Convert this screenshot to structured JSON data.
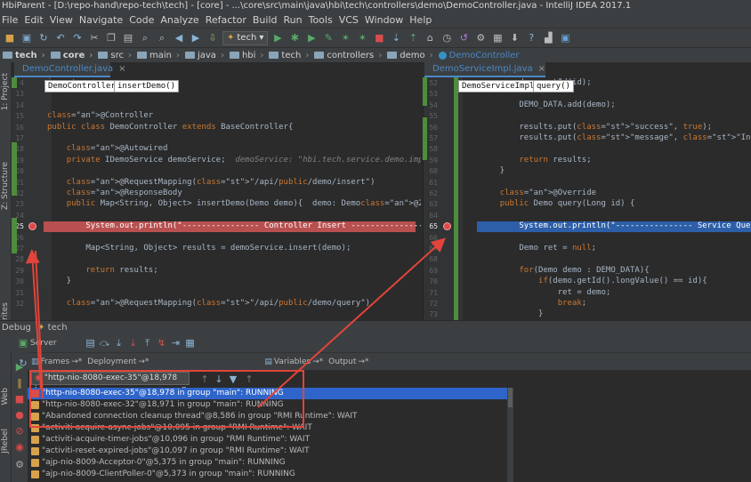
{
  "window": {
    "title": "HbiParent - [D:\\repo-hand\\repo-tech\\tech] - [core] - ...\\core\\src\\main\\java\\hbi\\tech\\controllers\\demo\\DemoController.java - IntelliJ IDEA 2017.1"
  },
  "menu": [
    "File",
    "Edit",
    "View",
    "Navigate",
    "Code",
    "Analyze",
    "Refactor",
    "Build",
    "Run",
    "Tools",
    "VCS",
    "Window",
    "Help"
  ],
  "toolbar": {
    "run_config": "tech"
  },
  "breadcrumbs": [
    "tech",
    "core",
    "src",
    "main",
    "java",
    "hbi",
    "tech",
    "controllers",
    "demo",
    "DemoController"
  ],
  "left_tabs": [
    "1: Project",
    "Z: Structure",
    "2: Favorites",
    "Web",
    "JRebel"
  ],
  "left_editor": {
    "tab": "DemoController.java",
    "crumbs": [
      "DemoController",
      "insertDemo()"
    ],
    "lines": [
      {
        "n": "4",
        "t": "import ..."
      },
      {
        "n": "13",
        "t": ""
      },
      {
        "n": "14",
        "t": ""
      },
      {
        "n": "15",
        "t": "@Controller"
      },
      {
        "n": "16",
        "t": "public class DemoController extends BaseController{"
      },
      {
        "n": "17",
        "t": ""
      },
      {
        "n": "18",
        "t": "    @Autowired"
      },
      {
        "n": "19",
        "t": "    private IDemoService demoService;  demoService: \"hbi.tech.service.demo.impl.Dem"
      },
      {
        "n": "20",
        "t": ""
      },
      {
        "n": "21",
        "t": "    @RequestMapping(\"/api/public/demo/insert\")"
      },
      {
        "n": "22",
        "t": "    @ResponseBody"
      },
      {
        "n": "23",
        "t": "    public Map<String, Object> insertDemo(Demo demo){  demo: Demo@20970"
      },
      {
        "n": "24",
        "t": ""
      },
      {
        "n": "25",
        "t": "        System.out.println(\"---------------- Controller Insert ----------------\");"
      },
      {
        "n": "26",
        "t": ""
      },
      {
        "n": "27",
        "t": "        Map<String, Object> results = demoService.insert(demo);"
      },
      {
        "n": "28",
        "t": ""
      },
      {
        "n": "29",
        "t": "        return results;"
      },
      {
        "n": "30",
        "t": "    }"
      },
      {
        "n": "31",
        "t": ""
      },
      {
        "n": "32",
        "t": "    @RequestMapping(\"/api/public/demo/query\")"
      }
    ]
  },
  "right_editor": {
    "tab": "DemoServiceImpl.java",
    "crumbs": [
      "DemoServiceImpl",
      "query()"
    ],
    "lines": [
      {
        "n": "52",
        "t": "        demo.setId(id);"
      },
      {
        "n": "53",
        "t": ""
      },
      {
        "n": "54",
        "t": "        DEMO_DATA.add(demo);"
      },
      {
        "n": "55",
        "t": ""
      },
      {
        "n": "56",
        "t": "        results.put(\"success\", true);"
      },
      {
        "n": "57",
        "t": "        results.put(\"message\", \"Insert Success\");"
      },
      {
        "n": "58",
        "t": ""
      },
      {
        "n": "59",
        "t": "        return results;"
      },
      {
        "n": "60",
        "t": "    }"
      },
      {
        "n": "61",
        "t": ""
      },
      {
        "n": "62",
        "t": "    @Override"
      },
      {
        "n": "63",
        "t": "    public Demo query(Long id) {"
      },
      {
        "n": "64",
        "t": ""
      },
      {
        "n": "65",
        "t": "        System.out.println(\"---------------- Service Query ------"
      },
      {
        "n": "66",
        "t": ""
      },
      {
        "n": "67",
        "t": "        Demo ret = null;"
      },
      {
        "n": "68",
        "t": ""
      },
      {
        "n": "69",
        "t": "        for(Demo demo : DEMO_DATA){"
      },
      {
        "n": "70",
        "t": "            if(demo.getId().longValue() == id){"
      },
      {
        "n": "71",
        "t": "                ret = demo;"
      },
      {
        "n": "72",
        "t": "                break;"
      },
      {
        "n": "73",
        "t": "            }"
      }
    ]
  },
  "debug": {
    "title": "Debug",
    "config": "tech",
    "server_tab": "Server",
    "tabs": [
      "Frames",
      "Deployment",
      "Variables",
      "Output"
    ],
    "thread_combo": "\"http-nio-8080-exec-35\"@18,978 i...",
    "threads": [
      "\"http-nio-8080-exec-35\"@18,978 in group \"main\": RUNNING",
      "\"http-nio-8080-exec-32\"@18,971 in group \"main\": RUNNING",
      "\"Abandoned connection cleanup thread\"@8,586 in group \"RMI Runtime\": WAIT",
      "\"activiti-acquire-async-jobs\"@10,095 in group \"RMI Runtime\": WAIT",
      "\"activiti-acquire-timer-jobs\"@10,096 in group \"RMI Runtime\": WAIT",
      "\"activiti-reset-expired-jobs\"@10,097 in group \"RMI Runtime\": WAIT",
      "\"ajp-nio-8009-Acceptor-0\"@5,375 in group \"main\": RUNNING",
      "\"ajp-nio-8009-ClientPoller-0\"@5,373 in group \"main\": RUNNING"
    ]
  },
  "colors": {
    "accent": "#2f65ca",
    "breakpoint_line": "#b85050",
    "annotation_red": "#e0443a"
  }
}
